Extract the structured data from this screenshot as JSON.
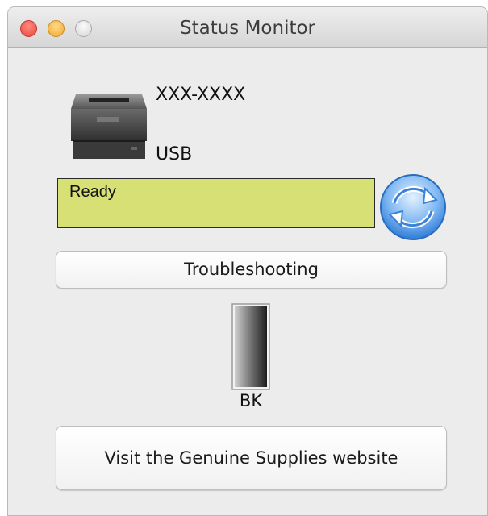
{
  "window": {
    "title": "Status Monitor"
  },
  "device": {
    "model": "XXX-XXXX",
    "connection": "USB"
  },
  "status": {
    "text": "Ready",
    "color": "#d6e075"
  },
  "toner": {
    "label": "BK",
    "level_fraction": 1.0,
    "color": "#222222"
  },
  "buttons": {
    "troubleshooting": "Troubleshooting",
    "supplies": "Visit the Genuine Supplies website"
  },
  "icons": {
    "refresh": "refresh-icon",
    "printer": "printer-icon"
  }
}
